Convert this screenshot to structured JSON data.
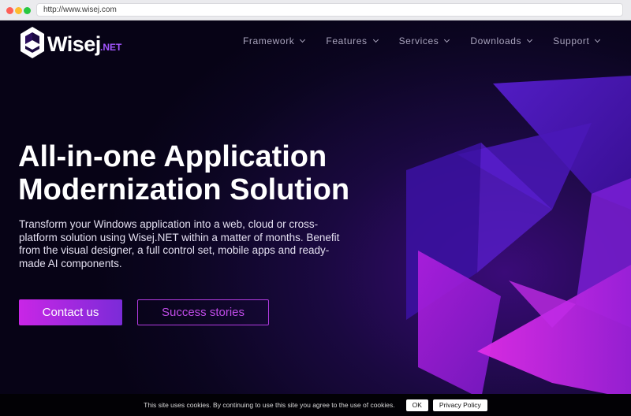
{
  "browser": {
    "url": "http://www.wisej.com"
  },
  "brand": {
    "name": "Wisej",
    "suffix": ".NET"
  },
  "nav": {
    "items": [
      {
        "label": "Framework"
      },
      {
        "label": "Features"
      },
      {
        "label": "Services"
      },
      {
        "label": "Downloads"
      },
      {
        "label": "Support"
      }
    ]
  },
  "hero": {
    "title_line1": "All-in-one Application",
    "title_line2": "Modernization Solution",
    "description": "Transform your Windows application into a web, cloud or cross-platform solution using Wisej.NET within a matter of months. Benefit from the visual designer, a full control set, mobile apps and ready-made AI components.",
    "primary_button": "Contact us",
    "secondary_button": "Success stories"
  },
  "cookie_bar": {
    "text": "This site uses cookies. By continuing to use this site you agree to the use of cookies.",
    "ok_label": "OK",
    "policy_label": "Privacy Policy"
  },
  "colors": {
    "accent": "#c926e6",
    "brand_purple": "#a356ff",
    "background": "#0b0520"
  },
  "icons": [
    "wisej-logo-icon",
    "chevron-down-icon"
  ]
}
